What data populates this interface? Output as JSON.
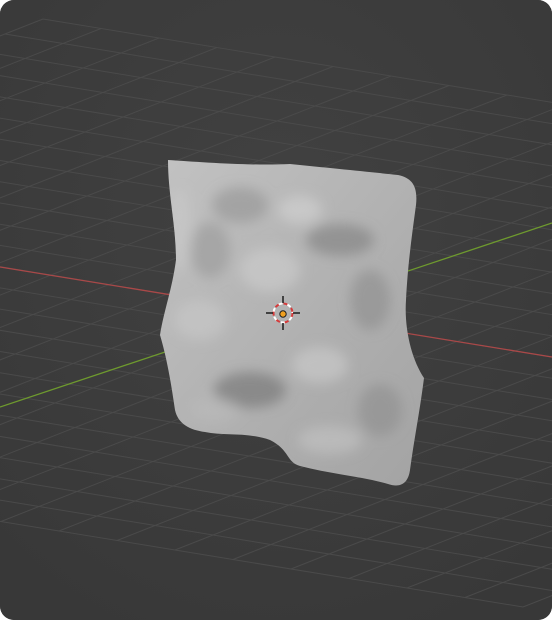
{
  "viewport": {
    "view": "3D Viewport",
    "background_color": "#3d3d3d",
    "grid_color": "#4a4a4a",
    "x_axis_color": "#a94848",
    "y_axis_color": "#6e9a2e"
  },
  "scene_object": {
    "type": "mesh",
    "shape": "displaced-plane",
    "shading": "solid",
    "base_color": "#b7b7b7"
  },
  "cursor_3d": {
    "icon": "3d-cursor-icon",
    "ring_colors": [
      "#d63a3a",
      "#ffffff"
    ]
  },
  "origin": {
    "icon": "object-origin-icon",
    "color": "#f0a020"
  }
}
